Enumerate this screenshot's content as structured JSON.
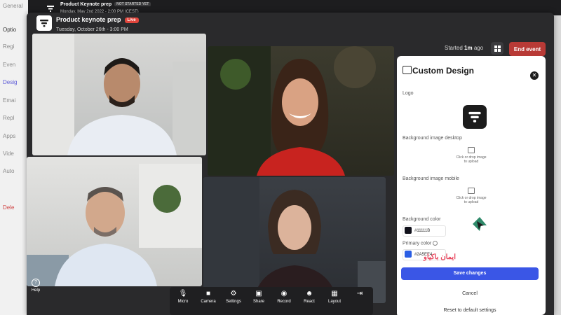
{
  "background_app": {
    "sidebar_items": [
      "General",
      "Optio",
      "Regi",
      "Even",
      "Desig",
      "Emai",
      "Repl",
      "Apps",
      "Vide",
      "Auto",
      "Dele"
    ],
    "title": "Product Keynote prep",
    "status": "NOT STARTED YET",
    "subtitle": "Monday, May 2nd 2022 - 2:00 PM (CEST)"
  },
  "window": {
    "title": "Product keynote prep",
    "live_label": "Live",
    "date": "Tuesday, October 26th - 3:00 PM",
    "started_prefix": "Started",
    "started_time": "1m",
    "started_suffix": "ago",
    "end_event": "End event"
  },
  "controls": [
    {
      "label": "Micro",
      "icon": "microphone-icon",
      "glyph": "🎙"
    },
    {
      "label": "Camera",
      "icon": "camera-icon",
      "glyph": "■"
    },
    {
      "label": "Settings",
      "icon": "gear-icon",
      "glyph": "⚙"
    },
    {
      "label": "Share",
      "icon": "share-icon",
      "glyph": "▣"
    },
    {
      "label": "Record",
      "icon": "record-icon",
      "glyph": "◉"
    },
    {
      "label": "React",
      "icon": "react-icon",
      "glyph": "☻"
    },
    {
      "label": "Layout",
      "icon": "layout-icon",
      "glyph": "▦"
    },
    {
      "label": "",
      "icon": "leave-icon",
      "glyph": "⇥"
    }
  ],
  "help_label": "Help",
  "more_glyph": "•••",
  "panel": {
    "title": "Custom Design",
    "logo_label": "Logo",
    "bg_desktop_label": "Background image desktop",
    "bg_mobile_label": "Background image mobile",
    "drop_text_1": "Click or drop image",
    "drop_text_2": "to upload",
    "bg_color_label": "Background color",
    "bg_color_value": "#11111B",
    "primary_color_label": "Primary color",
    "primary_color_value": "#2A5EE4",
    "save": "Save changes",
    "cancel": "Cancel",
    "reset": "Reset to default settings"
  },
  "watermark": "ایمان باکیاو",
  "colors": {
    "end_button": "#b83a36",
    "save_button": "#3a56e6",
    "live_badge": "#e0453c"
  }
}
